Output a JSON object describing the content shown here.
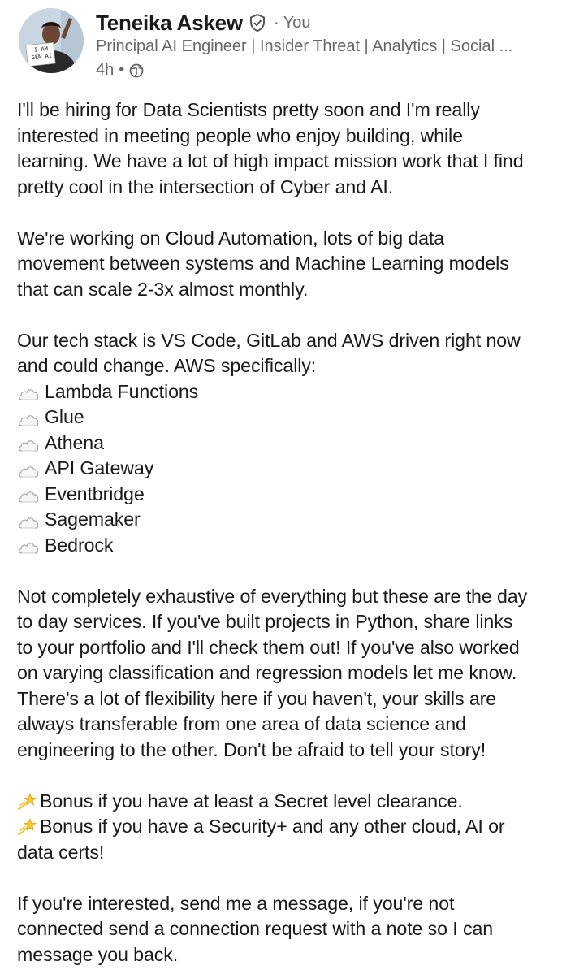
{
  "author": {
    "name": "Teneika Askew",
    "connection": "· You",
    "headline": "Principal AI Engineer | Insider Threat | Analytics | Social ...",
    "time": "4h",
    "meta_sep": "•",
    "avatar_sign": [
      "I AM",
      "GEN AI"
    ]
  },
  "icons": {
    "verified": "shield-check-icon",
    "visibility": "globe-icon",
    "bullet": "cloud-emoji",
    "bonus": "dizzy-star-emoji"
  },
  "post": {
    "para1": [
      "I'll be hiring for Data Scientists pretty soon and I'm really",
      "interested in meeting people who enjoy building, while",
      "learning. We have a lot of high impact mission work that I find",
      "pretty cool in the intersection of Cyber and AI."
    ],
    "para2": [
      "We're working on Cloud Automation, lots of big data",
      "movement between systems and Machine Learning models",
      "that can scale 2-3x almost monthly."
    ],
    "para3": [
      "Our tech stack is VS Code, GitLab and AWS driven right now",
      "and could change. AWS specifically:"
    ],
    "services": [
      "Lambda Functions",
      "Glue",
      "Athena",
      "API Gateway",
      "Eventbridge",
      "Sagemaker",
      "Bedrock"
    ],
    "para4": [
      "Not completely exhaustive of everything but these are the day",
      "to day services. If you've built projects in Python, share links",
      "to your portfolio and I'll check them out! If you've also worked",
      "on varying classification and regression models let me know.",
      "There's a lot of flexibility here if you haven't, your skills are",
      "always transferable from one area of data science and",
      "engineering to the other. Don't be afraid to tell your story!"
    ],
    "bonus1": "Bonus if you have at least a Secret level clearance.",
    "bonus2_line1": "Bonus if you have a Security+ and any other cloud, AI or",
    "bonus2_line2": "data certs!",
    "para5": [
      "If you're interested, send me a message, if you're not",
      "connected send a connection request with a note so I can",
      "message you back."
    ]
  },
  "colors": {
    "text": "#1a1a1a",
    "muted": "#666666",
    "background": "#ffffff"
  }
}
